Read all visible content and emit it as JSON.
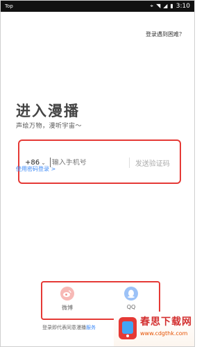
{
  "status_bar": {
    "left": "Top",
    "time": "3:10"
  },
  "help_link": "登录遇到困难？",
  "title": "进入漫播",
  "subtitle": "声绘万物，漫听宇宙～",
  "phone_form": {
    "country_code": "+86",
    "phone_placeholder": "输入手机号",
    "send_code": "发送验证码"
  },
  "password_login": "使用密码登录 >",
  "social": [
    {
      "label": "微博",
      "icon": "weibo-icon"
    },
    {
      "label": "QQ",
      "icon": "qq-icon"
    }
  ],
  "agreement": {
    "prefix": "登录即代表同意漫播",
    "link": "服务"
  },
  "watermark": {
    "title": "春思下载网",
    "url": "www.cdgthk.com"
  },
  "colors": {
    "highlight": "#e53935",
    "link": "#3d8af7",
    "weibo": "#f7b9b6",
    "qq": "#9cc2f7"
  }
}
